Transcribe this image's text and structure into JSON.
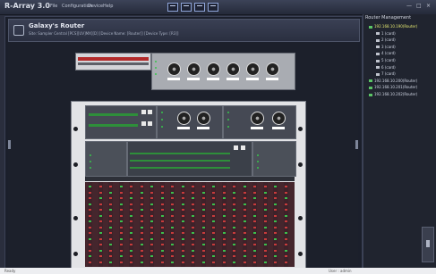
{
  "app": {
    "title": "R-Array 3.0"
  },
  "menu": {
    "items": [
      "File",
      "Configuration",
      "Device",
      "Help"
    ]
  },
  "toolbar": {
    "icons": [
      "list-icon",
      "grid-icon",
      "window-icon",
      "layout-icon"
    ]
  },
  "window_controls": {
    "minimize": "—",
    "maximize": "□",
    "close": "×"
  },
  "header": {
    "title": "Galaxy's Router",
    "subtitle": "Site: Sampler Central [PCS][UV]MX][D] [Device Name: [Router]] [Device Type: [R3]]"
  },
  "sidebar": {
    "title": "Router Management",
    "tree": [
      {
        "label": "192.168.10.190(Router)",
        "level": 0,
        "color": "green",
        "selected": true
      },
      {
        "label": "1 (card)",
        "level": 1,
        "color": "grey"
      },
      {
        "label": "2 (card)",
        "level": 1,
        "color": "grey"
      },
      {
        "label": "3 (card)",
        "level": 1,
        "color": "grey"
      },
      {
        "label": "4 (card)",
        "level": 1,
        "color": "grey"
      },
      {
        "label": "5 (card)",
        "level": 1,
        "color": "grey"
      },
      {
        "label": "6 (card)",
        "level": 1,
        "color": "grey"
      },
      {
        "label": "7 (card)",
        "level": 1,
        "color": "grey"
      },
      {
        "label": "192.168.10.200(Router)",
        "level": 0,
        "color": "green"
      },
      {
        "label": "192.168.10.201(Router)",
        "level": 0,
        "color": "green"
      },
      {
        "label": "192.168.10.202(Router)",
        "level": 0,
        "color": "green"
      }
    ]
  },
  "status": {
    "left": "Ready",
    "right": "User : admin"
  },
  "colors": {
    "app_bg": "#2a2e3d",
    "led_green": "#38c64b",
    "led_red": "#c73b3b",
    "selected_text": "#e6ea70"
  }
}
